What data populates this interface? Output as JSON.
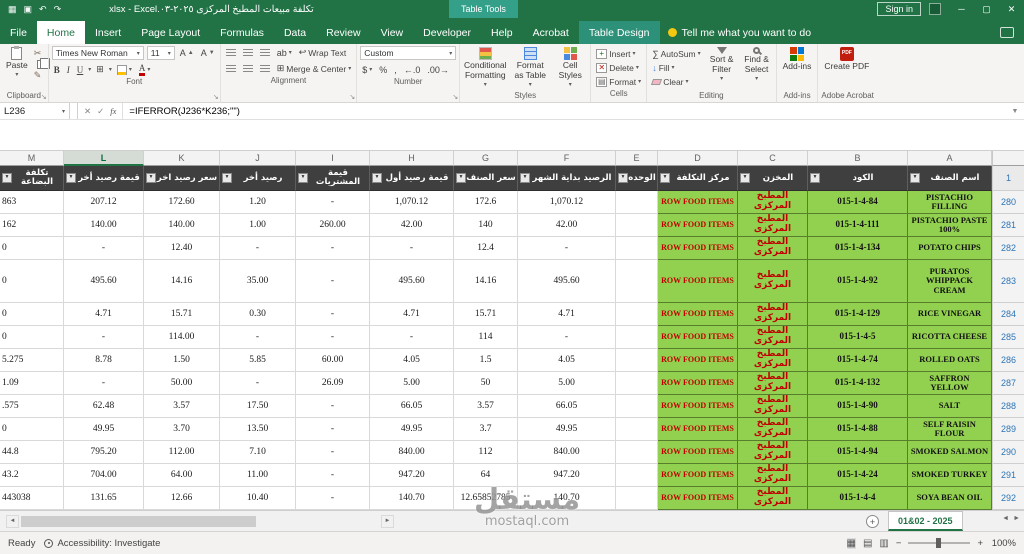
{
  "titlebar": {
    "title": "تكلفة مبيعات المطبخ المركزى ٢٠٢٥-٠٣.xlsx - Excel",
    "sign_in": "Sign in"
  },
  "tabs": {
    "items": [
      "File",
      "Home",
      "Insert",
      "Page Layout",
      "Formulas",
      "Data",
      "Review",
      "View",
      "Developer",
      "Help",
      "Acrobat"
    ],
    "active": "Home",
    "contextual_header": "Table Tools",
    "contextual_tab": "Table Design",
    "tell_me": "Tell me what you want to do"
  },
  "ribbon": {
    "clipboard": {
      "label": "Clipboard",
      "paste": "Paste"
    },
    "font": {
      "label": "Font",
      "family": "Times New Roman",
      "size": "11"
    },
    "alignment": {
      "label": "Alignment",
      "wrap": "Wrap Text",
      "merge": "Merge & Center"
    },
    "number": {
      "label": "Number",
      "format": "Custom"
    },
    "styles": {
      "label": "Styles",
      "conditional": "Conditional Formatting",
      "format_table": "Format as Table",
      "cell_styles": "Cell Styles"
    },
    "cells": {
      "label": "Cells",
      "insert": "Insert",
      "delete": "Delete",
      "format": "Format"
    },
    "editing": {
      "label": "Editing",
      "autosum": "AutoSum",
      "fill": "Fill",
      "clear": "Clear",
      "sort": "Sort & Filter",
      "find": "Find & Select"
    },
    "addins": {
      "label": "Add-ins",
      "button": "Add-ins"
    },
    "acrobat": {
      "label": "Adobe Acrobat",
      "create_pdf": "Create PDF"
    }
  },
  "formula_bar": {
    "name_box": "L236",
    "formula": "=IFERROR(J236*K236;\"\")"
  },
  "grid": {
    "column_letters": [
      "M",
      "L",
      "K",
      "J",
      "I",
      "H",
      "G",
      "F",
      "E",
      "D",
      "C",
      "B",
      "A"
    ],
    "selected_column": "L",
    "headers": [
      "تكلفة البضاعة",
      "قيمة رصيد أخر",
      "سعر رصيد اخر",
      "رصيد أخر",
      "قيمة المشتريات",
      "قيمة رصيد أول",
      "سعر الصنف",
      "الرصيد بداية الشهر",
      "الوحده",
      "مركز التكلفة",
      "المخزن",
      "الكود",
      "اسم الصنف"
    ],
    "header_row_number": "1",
    "rows": [
      {
        "n": "280",
        "tall": false,
        "cells": [
          "863",
          "207.12",
          "172.60",
          "1.20",
          "-",
          "1,070.12",
          "172.6",
          "1,070.12",
          "",
          "ROW FOOD ITEMS",
          "المطبخ المركزى",
          "015-1-4-84",
          "PISTACHIO FILLING"
        ]
      },
      {
        "n": "281",
        "tall": false,
        "cells": [
          "162",
          "140.00",
          "140.00",
          "1.00",
          "260.00",
          "42.00",
          "140",
          "42.00",
          "",
          "ROW FOOD ITEMS",
          "المطبخ المركزى",
          "015-1-4-111",
          "PISTACHIO PASTE 100%"
        ]
      },
      {
        "n": "282",
        "tall": false,
        "cells": [
          "0",
          "-",
          "12.40",
          "-",
          "-",
          "-",
          "12.4",
          "-",
          "",
          "ROW FOOD ITEMS",
          "المطبخ المركزى",
          "015-1-4-134",
          "POTATO CHIPS"
        ]
      },
      {
        "n": "283",
        "tall": true,
        "cells": [
          "0",
          "495.60",
          "14.16",
          "35.00",
          "-",
          "495.60",
          "14.16",
          "495.60",
          "",
          "ROW FOOD ITEMS",
          "المطبخ المركزى",
          "015-1-4-92",
          "PURATOS WHIPPACK CREAM"
        ]
      },
      {
        "n": "284",
        "tall": false,
        "cells": [
          "0",
          "4.71",
          "15.71",
          "0.30",
          "-",
          "4.71",
          "15.71",
          "4.71",
          "",
          "ROW FOOD ITEMS",
          "المطبخ المركزى",
          "015-1-4-129",
          "RICE VINEGAR"
        ]
      },
      {
        "n": "285",
        "tall": false,
        "cells": [
          "0",
          "-",
          "114.00",
          "-",
          "-",
          "-",
          "114",
          "-",
          "",
          "ROW FOOD ITEMS",
          "المطبخ المركزى",
          "015-1-4-5",
          "RICOTTA CHEESE"
        ]
      },
      {
        "n": "286",
        "tall": false,
        "cells": [
          "5.275",
          "8.78",
          "1.50",
          "5.85",
          "60.00",
          "4.05",
          "1.5",
          "4.05",
          "",
          "ROW FOOD ITEMS",
          "المطبخ المركزى",
          "015-1-4-74",
          "ROLLED OATS"
        ]
      },
      {
        "n": "287",
        "tall": false,
        "cells": [
          "1.09",
          "-",
          "50.00",
          "-",
          "26.09",
          "5.00",
          "50",
          "5.00",
          "",
          "ROW FOOD ITEMS",
          "المطبخ المركزى",
          "015-1-4-132",
          "SAFFRON YELLOW"
        ]
      },
      {
        "n": "288",
        "tall": false,
        "cells": [
          ".575",
          "62.48",
          "3.57",
          "17.50",
          "-",
          "66.05",
          "3.57",
          "66.05",
          "",
          "ROW FOOD ITEMS",
          "المطبخ المركزى",
          "015-1-4-90",
          "SALT"
        ]
      },
      {
        "n": "289",
        "tall": false,
        "cells": [
          "0",
          "49.95",
          "3.70",
          "13.50",
          "-",
          "49.95",
          "3.7",
          "49.95",
          "",
          "ROW FOOD ITEMS",
          "المطبخ المركزى",
          "015-1-4-88",
          "SELF RAISIN FLOUR"
        ]
      },
      {
        "n": "290",
        "tall": false,
        "cells": [
          "44.8",
          "795.20",
          "112.00",
          "7.10",
          "-",
          "840.00",
          "112",
          "840.00",
          "",
          "ROW FOOD ITEMS",
          "المطبخ المركزى",
          "015-1-4-94",
          "SMOKED SALMON"
        ]
      },
      {
        "n": "291",
        "tall": false,
        "cells": [
          "43.2",
          "704.00",
          "64.00",
          "11.00",
          "-",
          "947.20",
          "64",
          "947.20",
          "",
          "ROW FOOD ITEMS",
          "المطبخ المركزى",
          "015-1-4-24",
          "SMOKED TURKEY"
        ]
      },
      {
        "n": "292",
        "tall": false,
        "cells": [
          "443038",
          "131.65",
          "12.66",
          "10.40",
          "-",
          "140.70",
          "12.65852785",
          "140.70",
          "",
          "ROW FOOD ITEMS",
          "المطبخ المركزى",
          "015-1-4-4",
          "SOYA BEAN OIL"
        ]
      }
    ]
  },
  "sheet_tabs": {
    "active": "01&02 - 2025"
  },
  "status_bar": {
    "mode": "Ready",
    "accessibility": "Accessibility: Investigate",
    "zoom": "100%"
  },
  "watermark": {
    "line1": "مستقل",
    "line2": "mostaql.com"
  }
}
